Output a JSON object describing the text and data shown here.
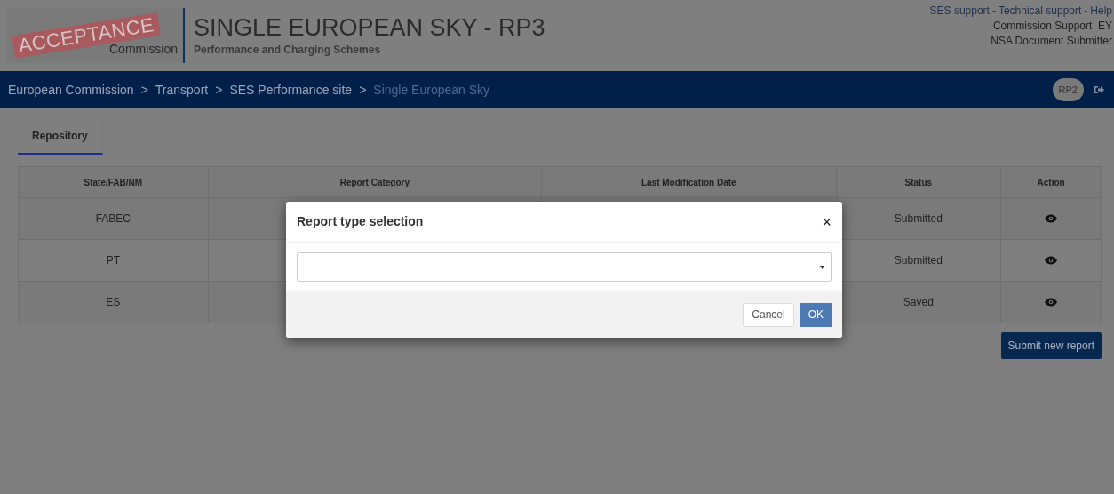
{
  "header": {
    "environment_stamp": "ACCEPTANCE",
    "logo_text": [
      "Commission"
    ],
    "title": "SINGLE EUROPEAN SKY - RP3",
    "subtitle": "Performance and Charging Schemes",
    "links": [
      "SES support",
      "-",
      "Technical support",
      "-",
      "Help"
    ],
    "user": "Commission Support  EY",
    "role": "NSA Document Submitter"
  },
  "breadcrumbs": [
    {
      "label": "European Commission",
      "current": false
    },
    {
      "label": "Transport",
      "current": false
    },
    {
      "label": "SES Performance site",
      "current": false
    },
    {
      "label": "Single European Sky",
      "current": true
    }
  ],
  "breadcrumb_separator": ">",
  "period_badge": "RP2",
  "tabs": [
    {
      "label": "Repository",
      "selected": true
    }
  ],
  "table": {
    "columns": [
      "State/FAB/NM",
      "Report Category",
      "Last Modification Date",
      "Status",
      "Action"
    ],
    "rows": [
      {
        "state": "FABEC",
        "status": "Submitted"
      },
      {
        "state": "PT",
        "status": "Submitted"
      },
      {
        "state": "ES",
        "status": "Saved"
      }
    ]
  },
  "submit_button": "Submit new report",
  "dialog": {
    "title": "Report type selection",
    "close": "×",
    "buttons": [
      {
        "label": "Cancel",
        "kind": "default"
      },
      {
        "label": "OK",
        "kind": "primary"
      }
    ]
  }
}
